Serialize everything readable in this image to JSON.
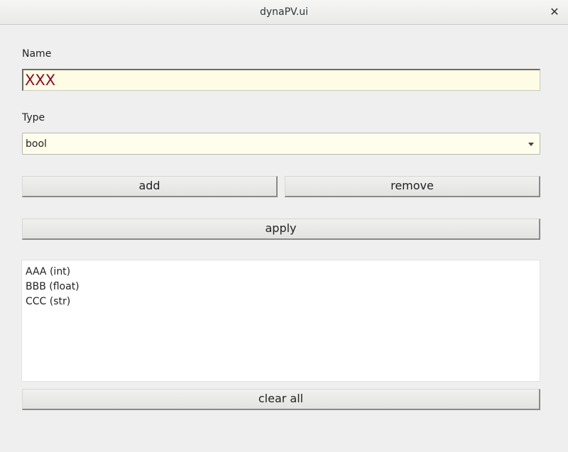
{
  "window": {
    "title": "dynaPV.ui",
    "close_glyph": "✕"
  },
  "form": {
    "name_label": "Name",
    "name_value": "XXX",
    "type_label": "Type",
    "type_value": "bool"
  },
  "buttons": {
    "add": "add",
    "remove": "remove",
    "apply": "apply",
    "clear_all": "clear all"
  },
  "variables": [
    {
      "label": "AAA (int)"
    },
    {
      "label": "BBB (float)"
    },
    {
      "label": "CCC (str)"
    }
  ],
  "colors": {
    "input_background": "#fffce5",
    "input_text": "#8b0a2b"
  }
}
